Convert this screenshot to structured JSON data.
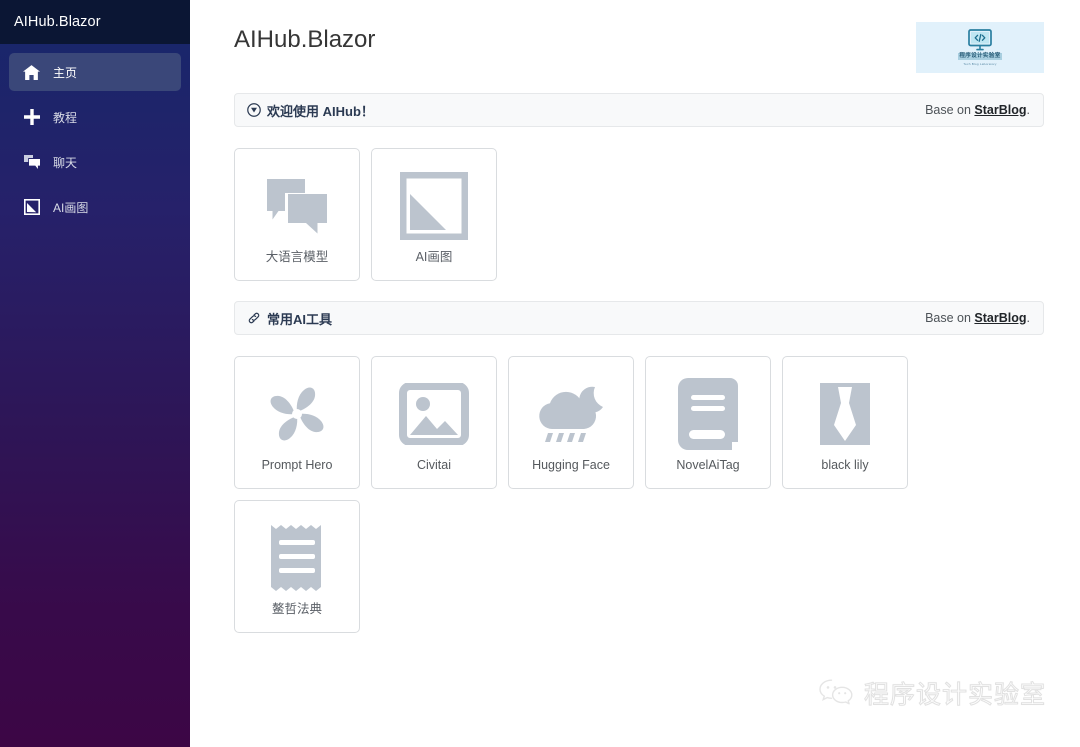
{
  "sidebar": {
    "brand": "AIHub.Blazor",
    "items": [
      {
        "label": "主页",
        "icon": "home-icon",
        "active": true
      },
      {
        "label": "教程",
        "icon": "plus-icon",
        "active": false
      },
      {
        "label": "聊天",
        "icon": "chat-icon",
        "active": false
      },
      {
        "label": "AI画图",
        "icon": "image-icon",
        "active": false
      }
    ],
    "colors": {
      "top": "#0b1634",
      "gradient_start": "#16276b",
      "gradient_end": "#3c0645",
      "active_bg": "#3a4779"
    }
  },
  "header": {
    "title": "AIHub.Blazor",
    "logo": {
      "icon": "code-monitor-icon",
      "cn_text": "程序设计实验室",
      "en_text": "Tech Blog Laboratory",
      "bg": "#e1f1fb"
    }
  },
  "sections": [
    {
      "icon": "compass-icon",
      "title": "欢迎使用 AIHub！",
      "credit_prefix": "Base on ",
      "credit_link": "StarBlog",
      "credit_suffix": ".",
      "tiles": [
        {
          "label": "大语言模型",
          "icon": "chat-bubbles-icon"
        },
        {
          "label": "AI画图",
          "icon": "picture-icon"
        }
      ]
    },
    {
      "icon": "link-icon",
      "title": "常用AI工具",
      "credit_prefix": "Base on ",
      "credit_link": "StarBlog",
      "credit_suffix": ".",
      "tiles": [
        {
          "label": "Prompt Hero",
          "icon": "fan-icon"
        },
        {
          "label": "Civitai",
          "icon": "image-frame-icon"
        },
        {
          "label": "Hugging Face",
          "icon": "cloud-moon-rain-icon"
        },
        {
          "label": "NovelAiTag",
          "icon": "book-icon"
        },
        {
          "label": "black lily",
          "icon": "tie-icon"
        },
        {
          "label": "鳌哲法典",
          "icon": "receipt-icon"
        }
      ]
    }
  ],
  "watermark": {
    "icon": "wechat-icon",
    "text": "程序设计实验室"
  }
}
